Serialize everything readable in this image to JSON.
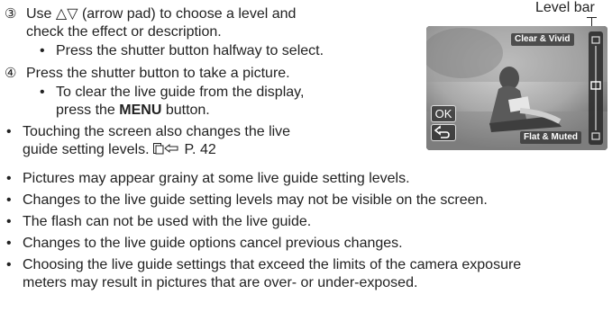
{
  "steps": {
    "step3": {
      "number": "③",
      "text_line1": "Use △▽ (arrow pad) to choose a level and",
      "text_line2": "check the effect or description.",
      "sub1": "Press the shutter button halfway to select."
    },
    "step4": {
      "number": "④",
      "text": "Press the shutter button to take a picture.",
      "sub1_line1": "To clear the live guide from the display,",
      "sub1_line2_pre": "press the ",
      "sub1_line2_bold": "MENU",
      "sub1_line2_post": " button."
    },
    "touch_note_line1": "Touching the screen also changes the live",
    "touch_note_line2_pre": "guide setting levels. ",
    "touch_note_ref_icon": "reference-book-icon",
    "touch_note_ref": "P. 42"
  },
  "figure": {
    "callout_label": "Level bar",
    "top_label": "Clear & Vivid",
    "bottom_label": "Flat & Muted",
    "ok_label": "OK",
    "back_icon": "back-arrow-icon"
  },
  "notes": [
    "Pictures may appear grainy at some live guide setting levels.",
    "Changes to the live guide setting levels may not be visible on the screen.",
    "The flash can not be used with the live guide.",
    "Changes to the live guide options cancel previous changes.",
    "Choosing the live guide settings that exceed the limits of the camera exposure",
    "meters may result in pictures that are over- or under-exposed."
  ]
}
